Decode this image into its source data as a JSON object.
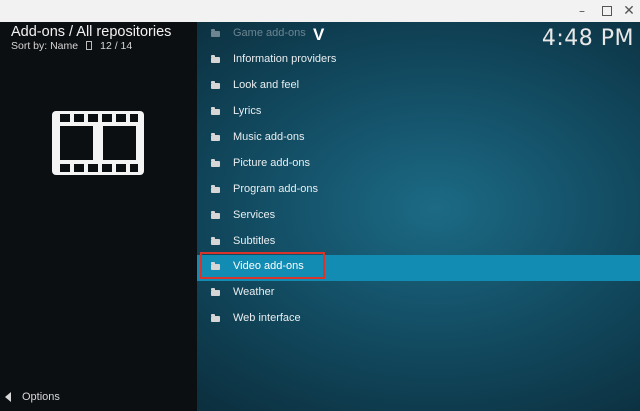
{
  "window": {
    "minimize_glyph": "–",
    "close_glyph": "✕"
  },
  "header": {
    "title": "Add-ons / All repositories",
    "sort_label": "Sort by: Name",
    "position": "12 / 14"
  },
  "clock": "4:48 PM",
  "watermark": "V",
  "left_panel": {
    "icon": "film-icon",
    "options_label": "Options"
  },
  "list": {
    "items": [
      {
        "label": "Game add-ons"
      },
      {
        "label": "Information providers"
      },
      {
        "label": "Look and feel"
      },
      {
        "label": "Lyrics"
      },
      {
        "label": "Music add-ons"
      },
      {
        "label": "Picture add-ons"
      },
      {
        "label": "Program add-ons"
      },
      {
        "label": "Services"
      },
      {
        "label": "Subtitles"
      },
      {
        "label": "Video add-ons"
      },
      {
        "label": "Weather"
      },
      {
        "label": "Web interface"
      }
    ],
    "selected_index": 9
  },
  "colors": {
    "selected_bg": "#128cb3",
    "highlight_border": "#d9342b",
    "left_panel_bg": "#0c0f12"
  }
}
